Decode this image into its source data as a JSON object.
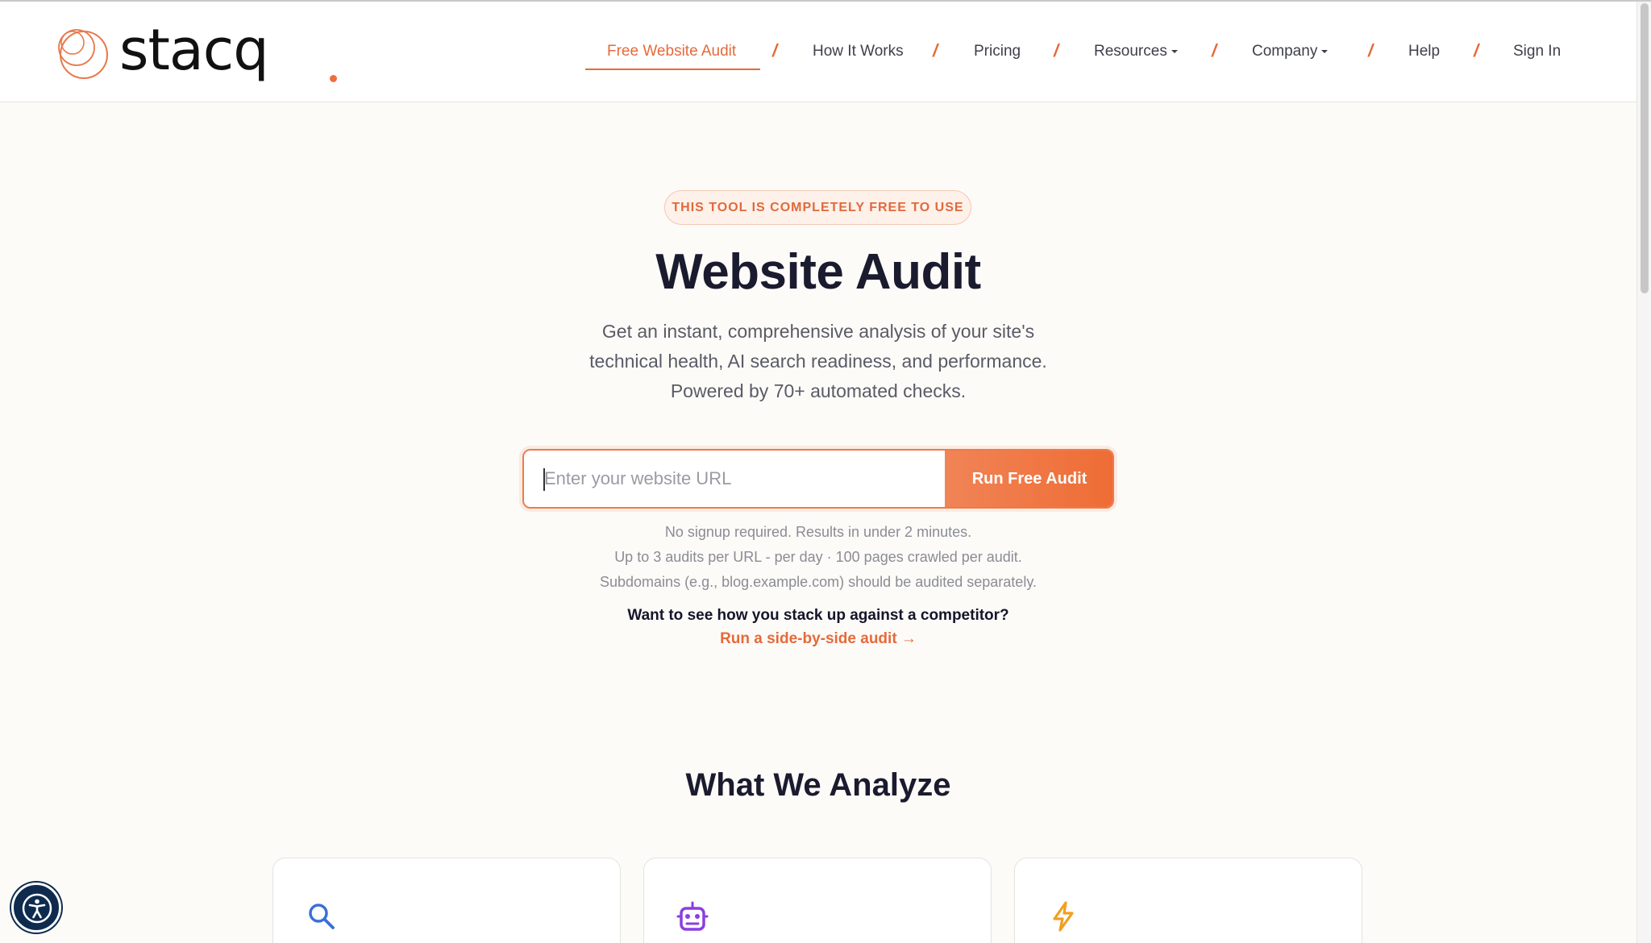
{
  "brand": {
    "name": "stacq",
    "accent": "#ef6f3c"
  },
  "nav": {
    "items": [
      {
        "label": "Free Website Audit",
        "active": true
      },
      {
        "label": "How It Works"
      },
      {
        "label": "Pricing"
      },
      {
        "label": "Resources",
        "dropdown": true
      },
      {
        "label": "Company",
        "dropdown": true
      },
      {
        "label": "Help"
      },
      {
        "label": "Sign In"
      }
    ],
    "separator": "/"
  },
  "hero": {
    "badge": "THIS TOOL IS COMPLETELY FREE TO USE",
    "title": "Website Audit",
    "subtitle_lines": [
      "Get an instant, comprehensive analysis of your site's",
      "technical health, AI search readiness, and performance.",
      "Powered by 70+ automated checks."
    ]
  },
  "search": {
    "placeholder": "Enter your website URL",
    "value": "",
    "button_label": "Run Free Audit"
  },
  "notes": [
    "No signup required. Results in under 2 minutes.",
    "Up to 3 audits per URL - per day · 100 pages crawled per audit.",
    "Subdomains (e.g., blog.example.com) should be audited separately."
  ],
  "competitor": {
    "question": "Want to see how you stack up against a competitor?",
    "link": "Run a side-by-side audit →"
  },
  "analyze": {
    "title": "What We Analyze",
    "cards": [
      {
        "icon": "search-icon",
        "color": "#3b6fd8"
      },
      {
        "icon": "robot-icon",
        "color": "#8a3fe0"
      },
      {
        "icon": "lightning-icon",
        "color": "#f0a020"
      }
    ]
  },
  "accessibility": {
    "icon": "accessibility-icon"
  }
}
